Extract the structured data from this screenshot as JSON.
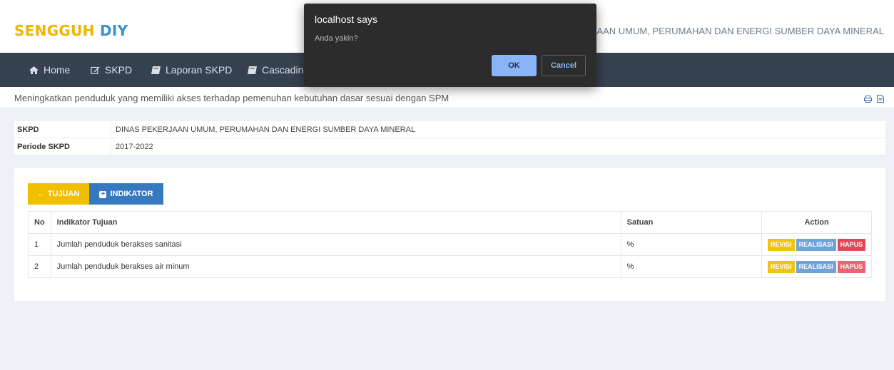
{
  "app": {
    "brand_part1": "SENGGUH",
    "brand_part2": "DIY",
    "department_title": "DINAS PEKERJAAN UMUM, PERUMAHAN DAN ENERGI SUMBER DAYA MINERAL"
  },
  "nav": {
    "items": [
      {
        "label": "Home",
        "icon": "home-icon"
      },
      {
        "label": "SKPD",
        "icon": "edit-icon"
      },
      {
        "label": "Laporan SKPD",
        "icon": "book-icon"
      },
      {
        "label": "Cascading",
        "icon": "book-icon"
      }
    ]
  },
  "page": {
    "title": "Meningkatkan penduduk yang memiliki akses terhadap pemenuhan kebutuhan dasar sesuai dengan SPM",
    "tools": [
      "print-icon",
      "export-icon"
    ]
  },
  "info": {
    "rows": [
      {
        "key": "SKPD",
        "value": "DINAS PEKERJAAN UMUM, PERUMAHAN DAN ENERGI SUMBER DAYA MINERAL"
      },
      {
        "key": "Periode SKPD",
        "value": "2017-2022"
      }
    ]
  },
  "buttons": {
    "tujuan": "TUJUAN",
    "indikator": "INDIKATOR"
  },
  "table": {
    "headers": {
      "no": "No",
      "indikator": "Indikator Tujuan",
      "satuan": "Satuan",
      "action": "Action"
    },
    "rows": [
      {
        "no": "1",
        "indikator": "Jumlah penduduk berakses sanitasi",
        "satuan": "%"
      },
      {
        "no": "2",
        "indikator": "Jumlah penduduk berakses air minum",
        "satuan": "%"
      }
    ],
    "actions": {
      "revisi": "REVISI",
      "realisasi": "REALISASI",
      "hapus": "HAPUS"
    }
  },
  "dialog": {
    "title": "localhost says",
    "message": "Anda yakin?",
    "ok_label": "OK",
    "cancel_label": "Cancel"
  },
  "colors": {
    "brand_yellow": "#f0b400",
    "brand_blue": "#3a8fd8",
    "navbar": "#364150",
    "tujuan_button": "#f0c000",
    "indikator_button": "#3779bf",
    "revisi": "#f1c40f",
    "realisasi": "#6fa2d8",
    "hapus": "#e04a58",
    "dialog_bg": "#2c2c2c",
    "dialog_ok": "#8ab4f8"
  }
}
